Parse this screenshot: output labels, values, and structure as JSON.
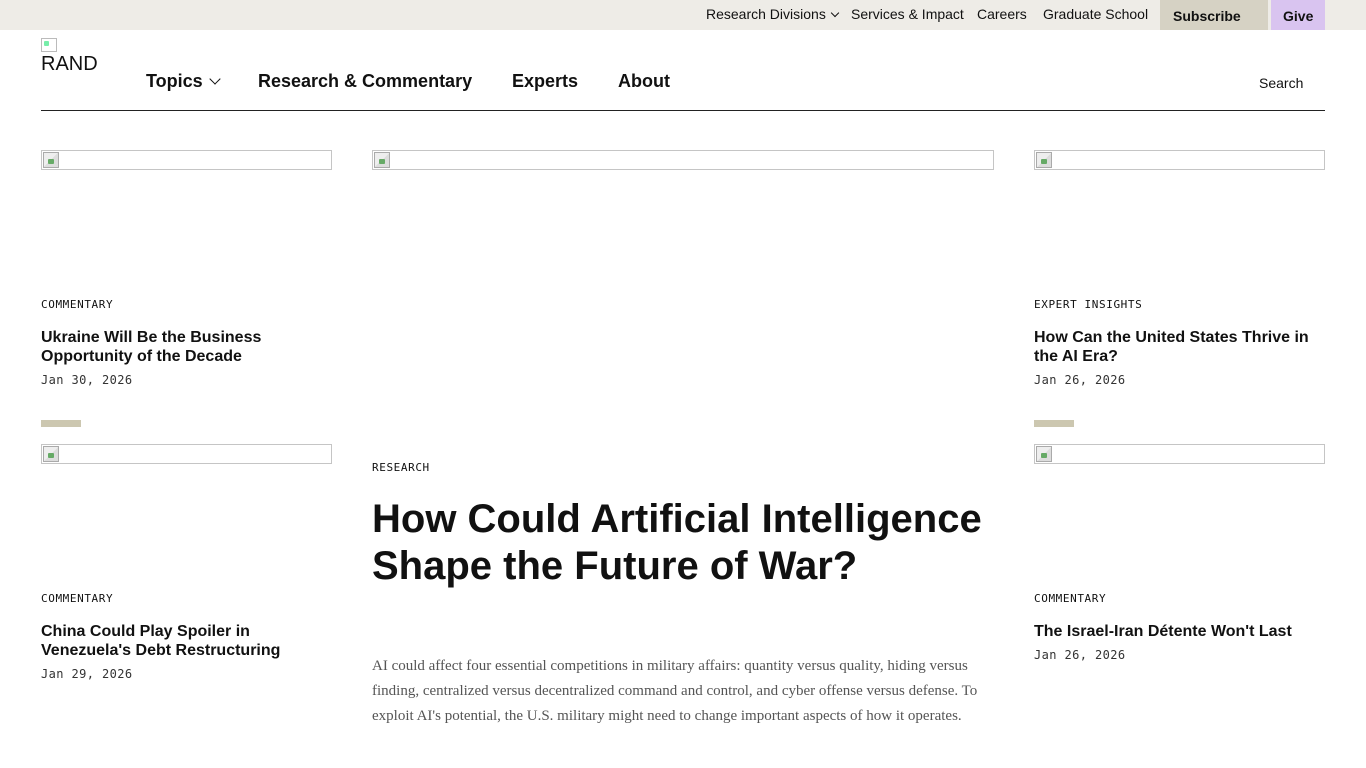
{
  "utility_nav": {
    "research_divisions": "Research Divisions",
    "services_impact": "Services & Impact",
    "careers": "Careers",
    "graduate_school": "Graduate School",
    "subscribe": "Subscribe",
    "give": "Give"
  },
  "header": {
    "logo_alt": "RAND",
    "nav": {
      "topics": "Topics",
      "research_commentary": "Research & Commentary",
      "experts": "Experts",
      "about": "About"
    },
    "search": "Search"
  },
  "stories": {
    "left_top": {
      "kicker": "COMMENTARY",
      "title": "Ukraine Will Be the Business Opportunity of the Decade",
      "date": "Jan 30, 2026"
    },
    "left_bottom": {
      "kicker": "COMMENTARY",
      "title": "China Could Play Spoiler in Venezuela's Debt Restructuring",
      "date": "Jan 29, 2026"
    },
    "right_top": {
      "kicker": "EXPERT INSIGHTS",
      "title": "How Can the United States Thrive in the AI Era?",
      "date": "Jan 26, 2026"
    },
    "right_bottom": {
      "kicker": "COMMENTARY",
      "title": "The Israel-Iran Détente Won't Last",
      "date": "Jan 26, 2026"
    }
  },
  "featured": {
    "kicker": "RESEARCH",
    "title": "How Could Artificial Intelligence Shape the Future of War?",
    "summary": "AI could affect four essential competitions in military affairs: quantity versus quality, hiding versus finding, centralized versus decentralized command and control, and cyber offense versus defense. To exploit AI's potential, the U.S. military might need to change important aspects of how it operates."
  },
  "colors": {
    "utility_bar_bg": "#eeece7",
    "subscribe_bg": "#d6d2c4",
    "give_bg": "#d9c4f0",
    "divider_accent": "#ccc7b0"
  },
  "icons": [
    "chevron-down-icon",
    "broken-image-icon"
  ]
}
